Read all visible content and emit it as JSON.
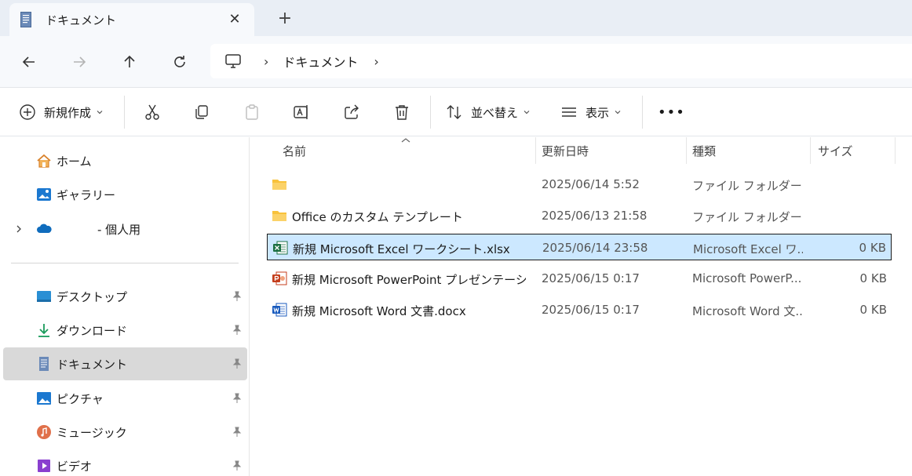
{
  "tab": {
    "title": "ドキュメント",
    "close": "✕",
    "new_tab": "+"
  },
  "address": {
    "crumb": "ドキュメント",
    "separator": "›"
  },
  "toolbar": {
    "new_label": "新規作成",
    "sort_label": "並べ替え",
    "view_label": "表示",
    "more": "•••"
  },
  "sidebar": {
    "items": [
      {
        "label": "ホーム",
        "icon": "home-icon"
      },
      {
        "label": "ギャラリー",
        "icon": "gallery-icon"
      },
      {
        "label": "- 個人用",
        "icon": "onedrive-icon"
      },
      {
        "label": "デスクトップ",
        "icon": "desktop-icon",
        "pinned": true
      },
      {
        "label": "ダウンロード",
        "icon": "download-icon",
        "pinned": true
      },
      {
        "label": "ドキュメント",
        "icon": "documents-icon",
        "pinned": true,
        "selected": true
      },
      {
        "label": "ピクチャ",
        "icon": "pictures-icon",
        "pinned": true
      },
      {
        "label": "ミュージック",
        "icon": "music-icon",
        "pinned": true
      },
      {
        "label": "ビデオ",
        "icon": "videos-icon",
        "pinned": true
      }
    ]
  },
  "columns": {
    "name": "名前",
    "modified": "更新日時",
    "type": "種類",
    "size": "サイズ"
  },
  "files": [
    {
      "name": "",
      "modified": "2025/06/14 5:52",
      "type": "ファイル フォルダー",
      "size": "",
      "icon": "folder-icon"
    },
    {
      "name": "Office のカスタム テンプレート",
      "modified": "2025/06/13 21:58",
      "type": "ファイル フォルダー",
      "size": "",
      "icon": "folder-icon"
    },
    {
      "name": "新規 Microsoft Excel ワークシート.xlsx",
      "modified": "2025/06/14 23:58",
      "type": "Microsoft Excel ワ...",
      "size": "0 KB",
      "icon": "excel-icon",
      "selected": true
    },
    {
      "name": "新規 Microsoft PowerPoint プレゼンテーショ...",
      "modified": "2025/06/15 0:17",
      "type": "Microsoft PowerP...",
      "size": "0 KB",
      "icon": "powerpoint-icon"
    },
    {
      "name": "新規 Microsoft Word 文書.docx",
      "modified": "2025/06/15 0:17",
      "type": "Microsoft Word 文...",
      "size": "0 KB",
      "icon": "word-icon"
    }
  ],
  "colors": {
    "accent": "#0067c0",
    "selection": "#cce8ff",
    "folder": "#f8c23b",
    "excel": "#1d7044",
    "powerpoint": "#c43e1c",
    "word": "#185abd"
  }
}
